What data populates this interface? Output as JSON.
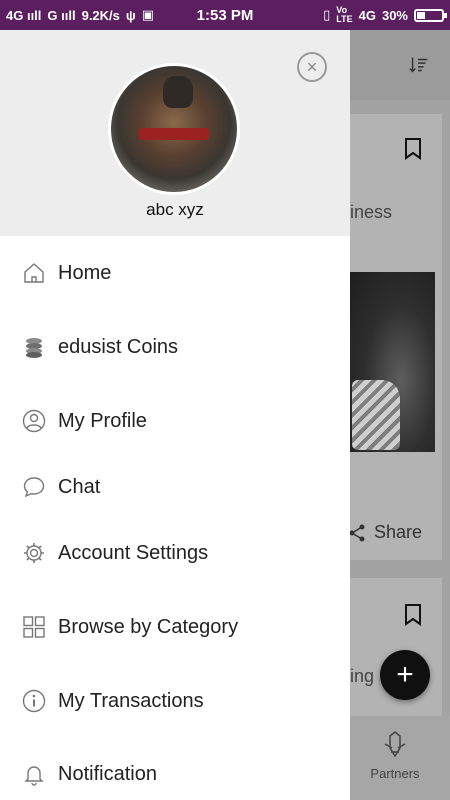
{
  "status_bar": {
    "left_text": "4G",
    "left_text2": "G",
    "net_speed": "9.2K/s",
    "time": "1:53 PM",
    "right_net": "4G",
    "battery_pct": "30%",
    "battery_level": 0.3
  },
  "drawer": {
    "username": "abc xyz",
    "menu": [
      {
        "label": "Home",
        "icon": "home-icon"
      },
      {
        "label": "edusist Coins",
        "icon": "coins-icon"
      },
      {
        "label": "My Profile",
        "icon": "profile-icon"
      },
      {
        "label": "Chat",
        "icon": "chat-icon"
      },
      {
        "label": "Account Settings",
        "icon": "gear-icon"
      },
      {
        "label": "Browse by Category",
        "icon": "grid-icon"
      },
      {
        "label": "My Transactions",
        "icon": "info-icon"
      },
      {
        "label": "Notification",
        "icon": "bell-icon"
      }
    ]
  },
  "background": {
    "card1_text": "iness",
    "share_label": "Share",
    "card2_text": "ing",
    "bottom_nav_partners": "Partners"
  },
  "colors": {
    "status_bar": "#5b1f5f",
    "drawer_header": "#ededed",
    "fab": "#101010"
  }
}
